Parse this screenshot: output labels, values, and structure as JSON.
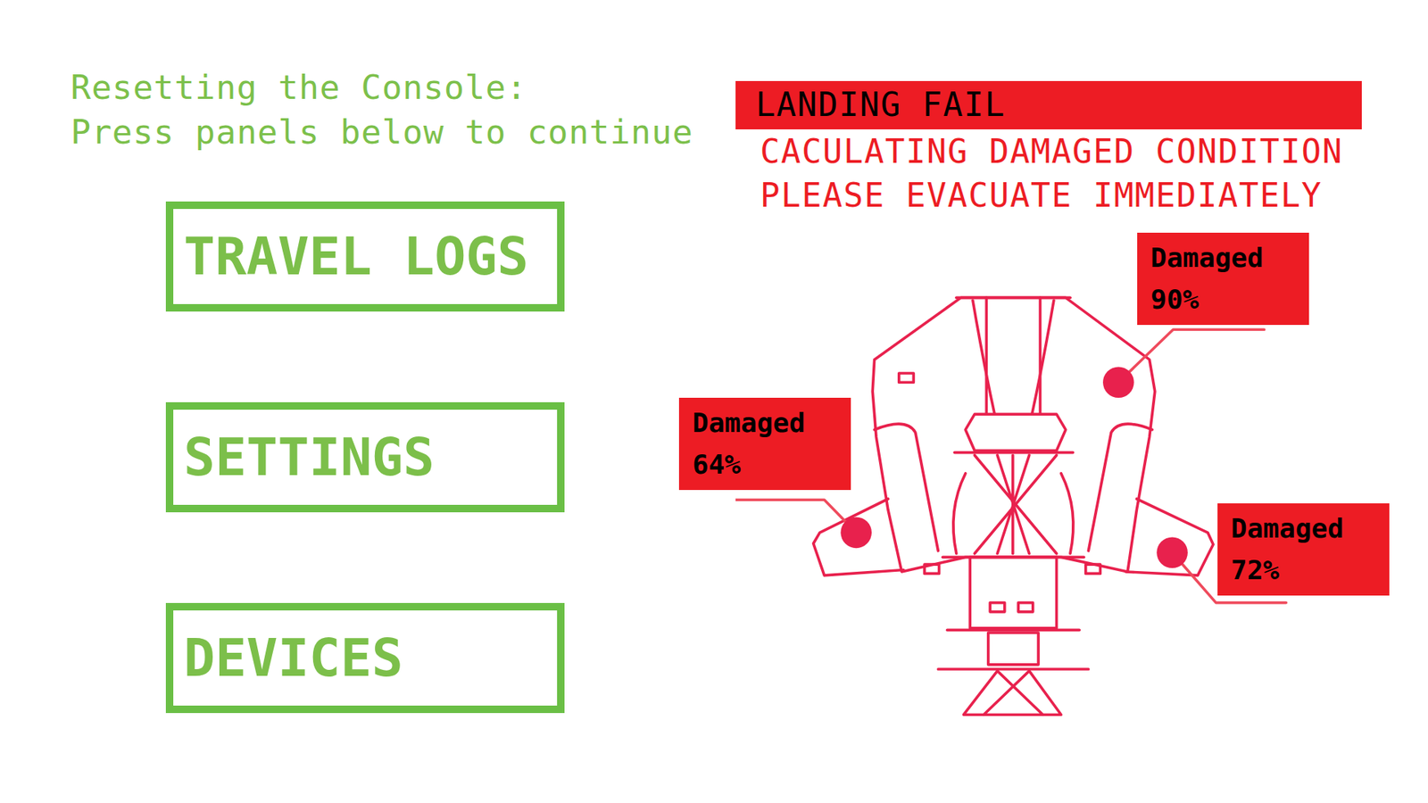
{
  "intro": [
    "Resetting the Console:",
    "Press panels below to continue"
  ],
  "buttons": [
    {
      "label": "TRAVEL LOGS"
    },
    {
      "label": "SETTINGS"
    },
    {
      "label": "DEVICES"
    }
  ],
  "alert": {
    "title": "LANDING FAIL",
    "lines": [
      "CACULATING DAMAGED CONDITION",
      "PLEASE EVACUATE IMMEDIATELY"
    ]
  },
  "damage": [
    {
      "label": "Damaged",
      "value": "90%"
    },
    {
      "label": "Damaged",
      "value": "64%"
    },
    {
      "label": "Damaged",
      "value": "72%"
    }
  ]
}
